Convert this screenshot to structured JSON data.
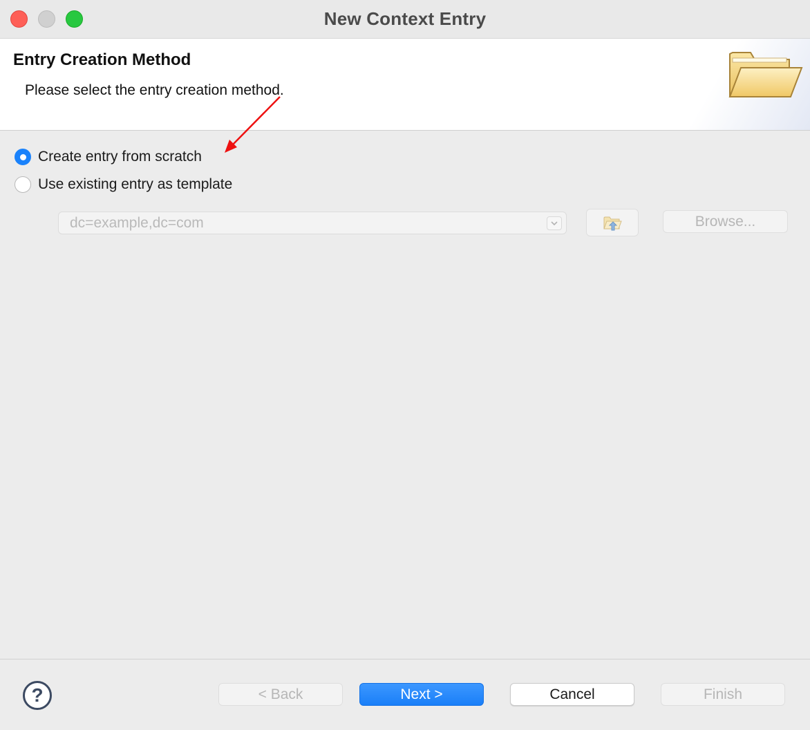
{
  "window": {
    "title": "New Context Entry"
  },
  "header": {
    "title": "Entry Creation Method",
    "description": "Please select the entry creation method.",
    "icon": "open-folder-icon"
  },
  "options": {
    "scratch": {
      "label": "Create entry from scratch",
      "selected": true
    },
    "template": {
      "label": "Use existing entry as template",
      "selected": false
    }
  },
  "template_dn": {
    "value": "dc=example,dc=com",
    "enabled": false
  },
  "buttons": {
    "browse": "Browse...",
    "back": "< Back",
    "next": "Next >",
    "cancel": "Cancel",
    "finish": "Finish",
    "help": "?"
  },
  "colors": {
    "accent": "#1a82fb",
    "annotation_arrow": "#ee1111"
  }
}
